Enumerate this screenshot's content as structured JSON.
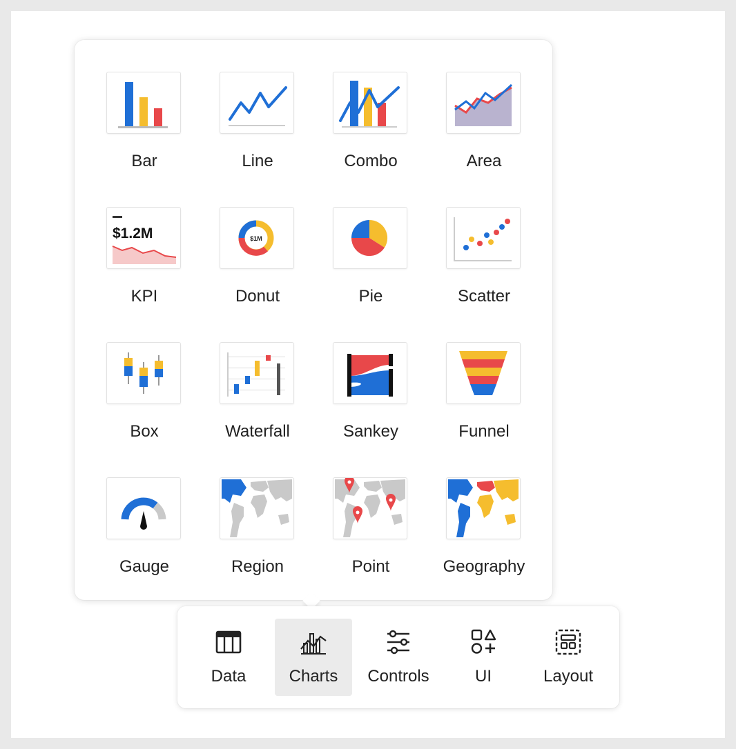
{
  "chart_picker": {
    "items": [
      {
        "label": "Bar",
        "icon": "bar-chart-icon"
      },
      {
        "label": "Line",
        "icon": "line-chart-icon"
      },
      {
        "label": "Combo",
        "icon": "combo-chart-icon"
      },
      {
        "label": "Area",
        "icon": "area-chart-icon"
      },
      {
        "label": "KPI",
        "icon": "kpi-icon",
        "value_text": "$1.2M"
      },
      {
        "label": "Donut",
        "icon": "donut-chart-icon",
        "value_text": "$1M"
      },
      {
        "label": "Pie",
        "icon": "pie-chart-icon"
      },
      {
        "label": "Scatter",
        "icon": "scatter-chart-icon"
      },
      {
        "label": "Box",
        "icon": "box-plot-icon"
      },
      {
        "label": "Waterfall",
        "icon": "waterfall-chart-icon"
      },
      {
        "label": "Sankey",
        "icon": "sankey-chart-icon"
      },
      {
        "label": "Funnel",
        "icon": "funnel-chart-icon"
      },
      {
        "label": "Gauge",
        "icon": "gauge-chart-icon"
      },
      {
        "label": "Region",
        "icon": "region-map-icon"
      },
      {
        "label": "Point",
        "icon": "point-map-icon"
      },
      {
        "label": "Geography",
        "icon": "geography-map-icon"
      }
    ]
  },
  "toolbar": {
    "active": "Charts",
    "items": [
      {
        "label": "Data",
        "icon": "table-icon"
      },
      {
        "label": "Charts",
        "icon": "charts-icon"
      },
      {
        "label": "Controls",
        "icon": "sliders-icon"
      },
      {
        "label": "UI",
        "icon": "shapes-icon"
      },
      {
        "label": "Layout",
        "icon": "layout-icon"
      }
    ]
  },
  "colors": {
    "blue": "#1f6fd6",
    "yellow": "#f5bd2e",
    "red": "#e8484a",
    "gray": "#c9c9c9",
    "dark": "#222222"
  }
}
